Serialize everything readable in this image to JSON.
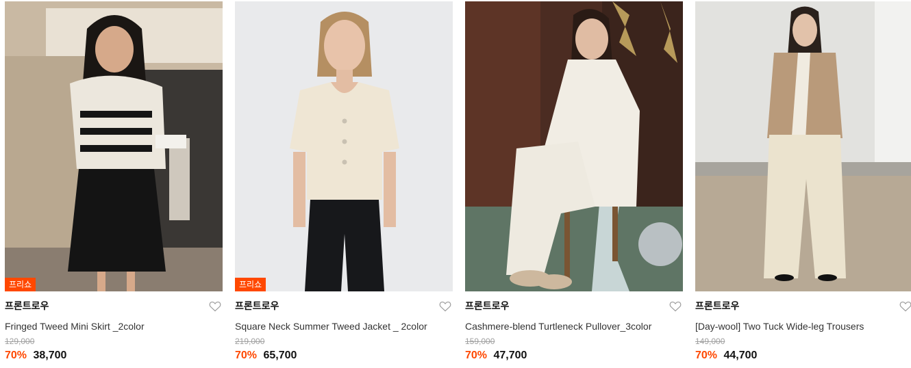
{
  "colors": {
    "accent": "#ff4800",
    "text_primary": "#111111",
    "text_secondary": "#333333",
    "text_muted": "#a0a0a0"
  },
  "products": [
    {
      "brand": "프론트로우",
      "name": "Fringed Tweed Mini Skirt _2color",
      "original_price": "129,000",
      "discount": "70%",
      "price": "38,700",
      "badge": "프리쇼",
      "wishlist_icon": "heart-outline-icon"
    },
    {
      "brand": "프론트로우",
      "name": "Square Neck Summer Tweed Jacket _ 2color",
      "original_price": "219,000",
      "discount": "70%",
      "price": "65,700",
      "badge": "프리쇼",
      "wishlist_icon": "heart-outline-icon"
    },
    {
      "brand": "프론트로우",
      "name": "Cashmere-blend Turtleneck Pullover_3color",
      "original_price": "159,000",
      "discount": "70%",
      "price": "47,700",
      "badge": "",
      "wishlist_icon": "heart-outline-icon"
    },
    {
      "brand": "프론트로우",
      "name": "[Day-wool] Two Tuck Wide-leg Trousers",
      "original_price": "149,000",
      "discount": "70%",
      "price": "44,700",
      "badge": "",
      "wishlist_icon": "heart-outline-icon"
    }
  ]
}
